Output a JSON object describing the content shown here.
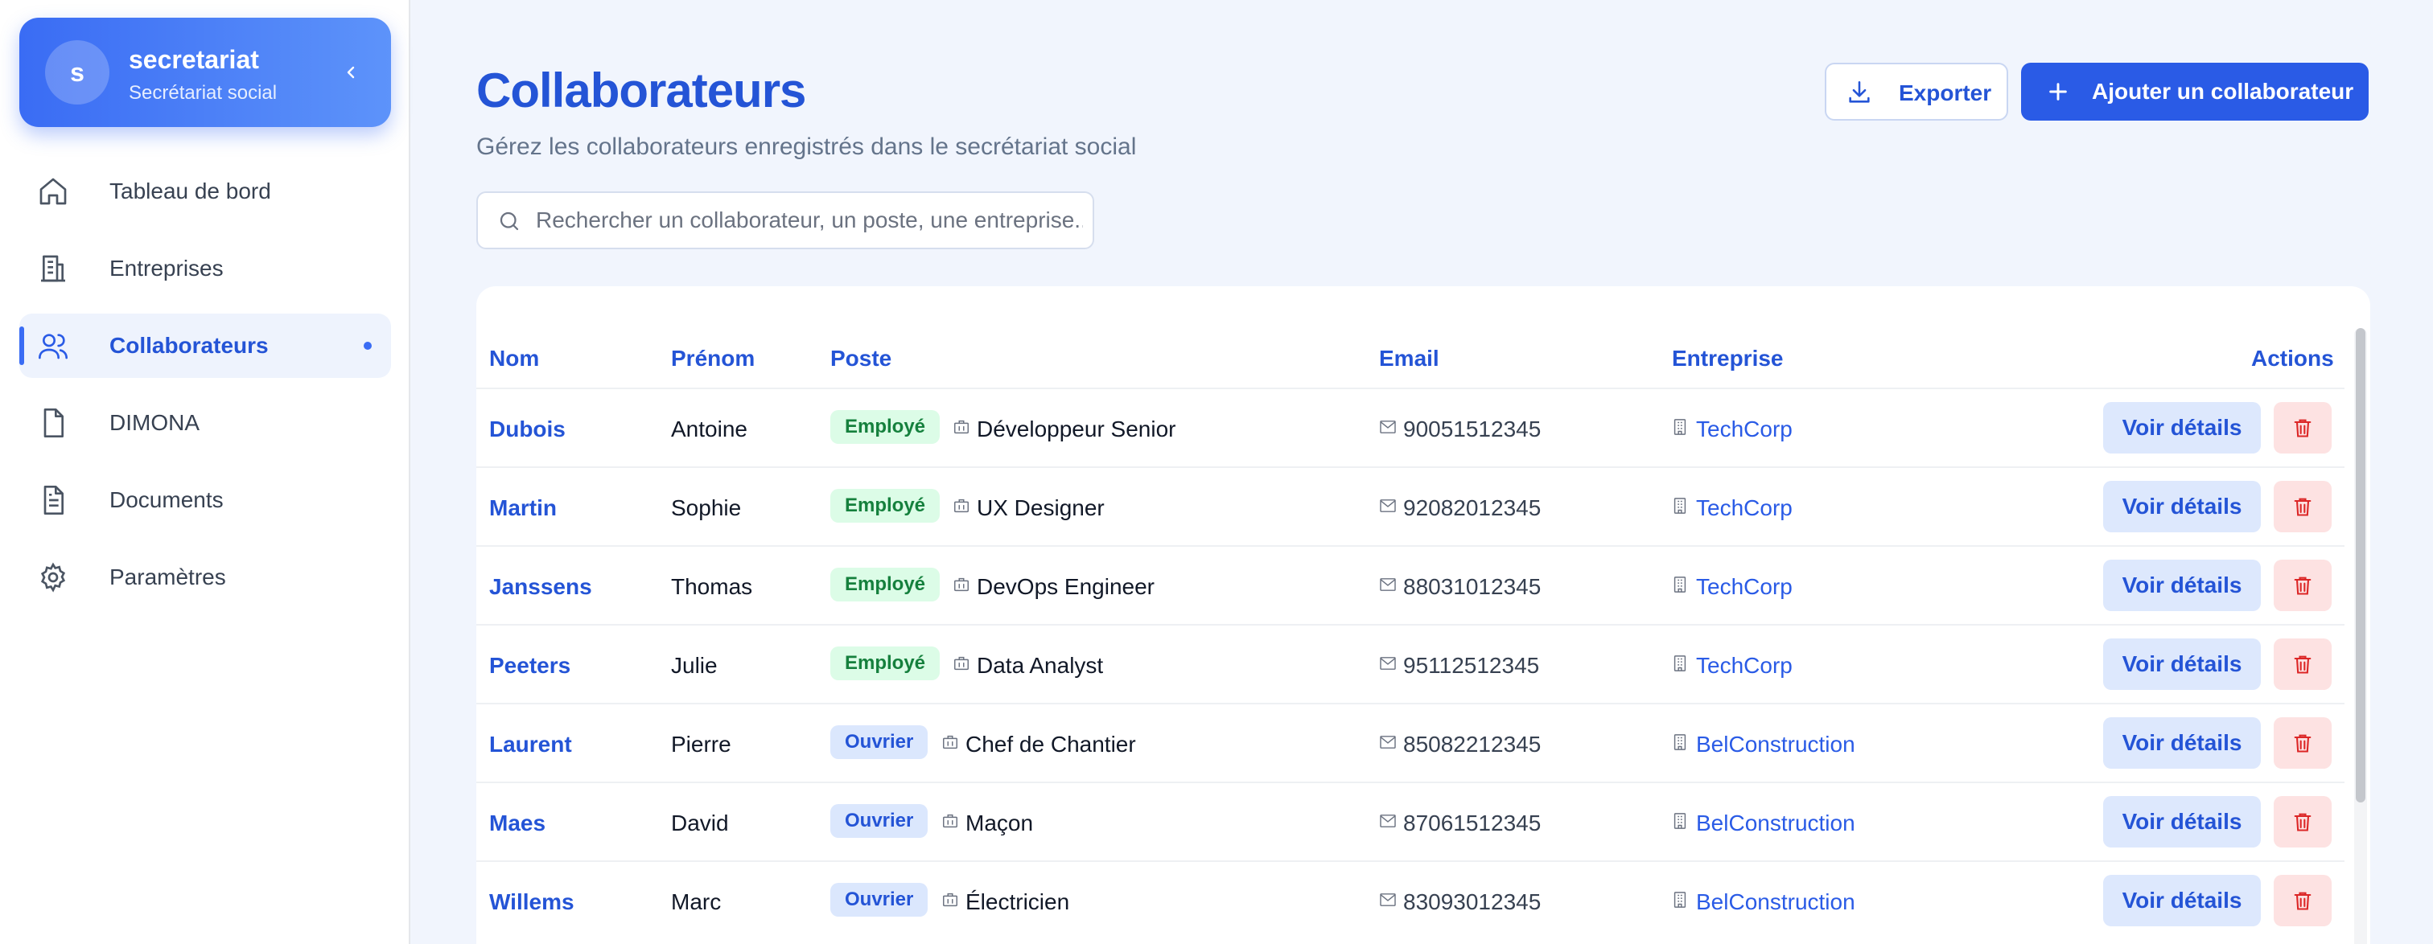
{
  "brand": {
    "initial": "s",
    "name": "secretariat",
    "subtitle": "Secrétariat social"
  },
  "nav": [
    {
      "label": "Tableau de bord",
      "icon": "home-icon"
    },
    {
      "label": "Entreprises",
      "icon": "building-icon"
    },
    {
      "label": "Collaborateurs",
      "icon": "users-icon",
      "active": true
    },
    {
      "label": "DIMONA",
      "icon": "file-icon"
    },
    {
      "label": "Documents",
      "icon": "document-icon"
    },
    {
      "label": "Paramètres",
      "icon": "gear-icon"
    }
  ],
  "header": {
    "title": "Collaborateurs",
    "subtitle": "Gérez les collaborateurs enregistrés dans le secrétariat social",
    "export_label": "Exporter",
    "add_label": "Ajouter un collaborateur"
  },
  "search": {
    "placeholder": "Rechercher un collaborateur, un poste, une entreprise..."
  },
  "table": {
    "columns": {
      "nom": "Nom",
      "prenom": "Prénom",
      "poste": "Poste",
      "email": "Email",
      "entreprise": "Entreprise",
      "actions": "Actions"
    },
    "view_label": "Voir détails",
    "rows": [
      {
        "nom": "Dubois",
        "prenom": "Antoine",
        "type": "Employé",
        "poste": "Développeur Senior",
        "email": "90051512345",
        "entreprise": "TechCorp"
      },
      {
        "nom": "Martin",
        "prenom": "Sophie",
        "type": "Employé",
        "poste": "UX Designer",
        "email": "92082012345",
        "entreprise": "TechCorp"
      },
      {
        "nom": "Janssens",
        "prenom": "Thomas",
        "type": "Employé",
        "poste": "DevOps Engineer",
        "email": "88031012345",
        "entreprise": "TechCorp"
      },
      {
        "nom": "Peeters",
        "prenom": "Julie",
        "type": "Employé",
        "poste": "Data Analyst",
        "email": "95112512345",
        "entreprise": "TechCorp"
      },
      {
        "nom": "Laurent",
        "prenom": "Pierre",
        "type": "Ouvrier",
        "poste": "Chef de Chantier",
        "email": "85082212345",
        "entreprise": "BelConstruction"
      },
      {
        "nom": "Maes",
        "prenom": "David",
        "type": "Ouvrier",
        "poste": "Maçon",
        "email": "87061512345",
        "entreprise": "BelConstruction"
      },
      {
        "nom": "Willems",
        "prenom": "Marc",
        "type": "Ouvrier",
        "poste": "Électricien",
        "email": "83093012345",
        "entreprise": "BelConstruction"
      }
    ]
  },
  "colors": {
    "accent": "#2a5be6",
    "title": "#2454d6",
    "employe_bg": "#dcfce7",
    "ouvrier_bg": "#dbe7fd",
    "danger": "#dc2626"
  }
}
